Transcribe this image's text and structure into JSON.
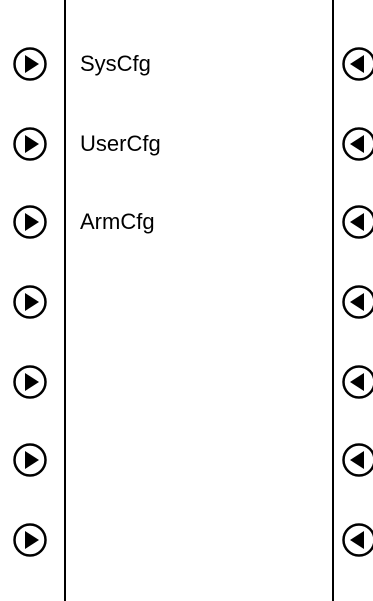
{
  "left_buttons": [
    {
      "icon": "play-right-icon"
    },
    {
      "icon": "play-right-icon"
    },
    {
      "icon": "play-right-icon"
    },
    {
      "icon": "play-right-icon"
    },
    {
      "icon": "play-right-icon"
    },
    {
      "icon": "play-right-icon"
    },
    {
      "icon": "play-right-icon"
    }
  ],
  "right_buttons": [
    {
      "icon": "play-left-icon"
    },
    {
      "icon": "play-left-icon"
    },
    {
      "icon": "play-left-icon"
    },
    {
      "icon": "play-left-icon"
    },
    {
      "icon": "play-left-icon"
    },
    {
      "icon": "play-left-icon"
    },
    {
      "icon": "play-left-icon"
    }
  ],
  "menu": {
    "items": [
      {
        "label": "SysCfg"
      },
      {
        "label": "UserCfg"
      },
      {
        "label": "ArmCfg"
      },
      {
        "label": ""
      },
      {
        "label": ""
      },
      {
        "label": ""
      },
      {
        "label": ""
      }
    ]
  },
  "colors": {
    "foreground": "#000000",
    "background": "#ffffff"
  }
}
